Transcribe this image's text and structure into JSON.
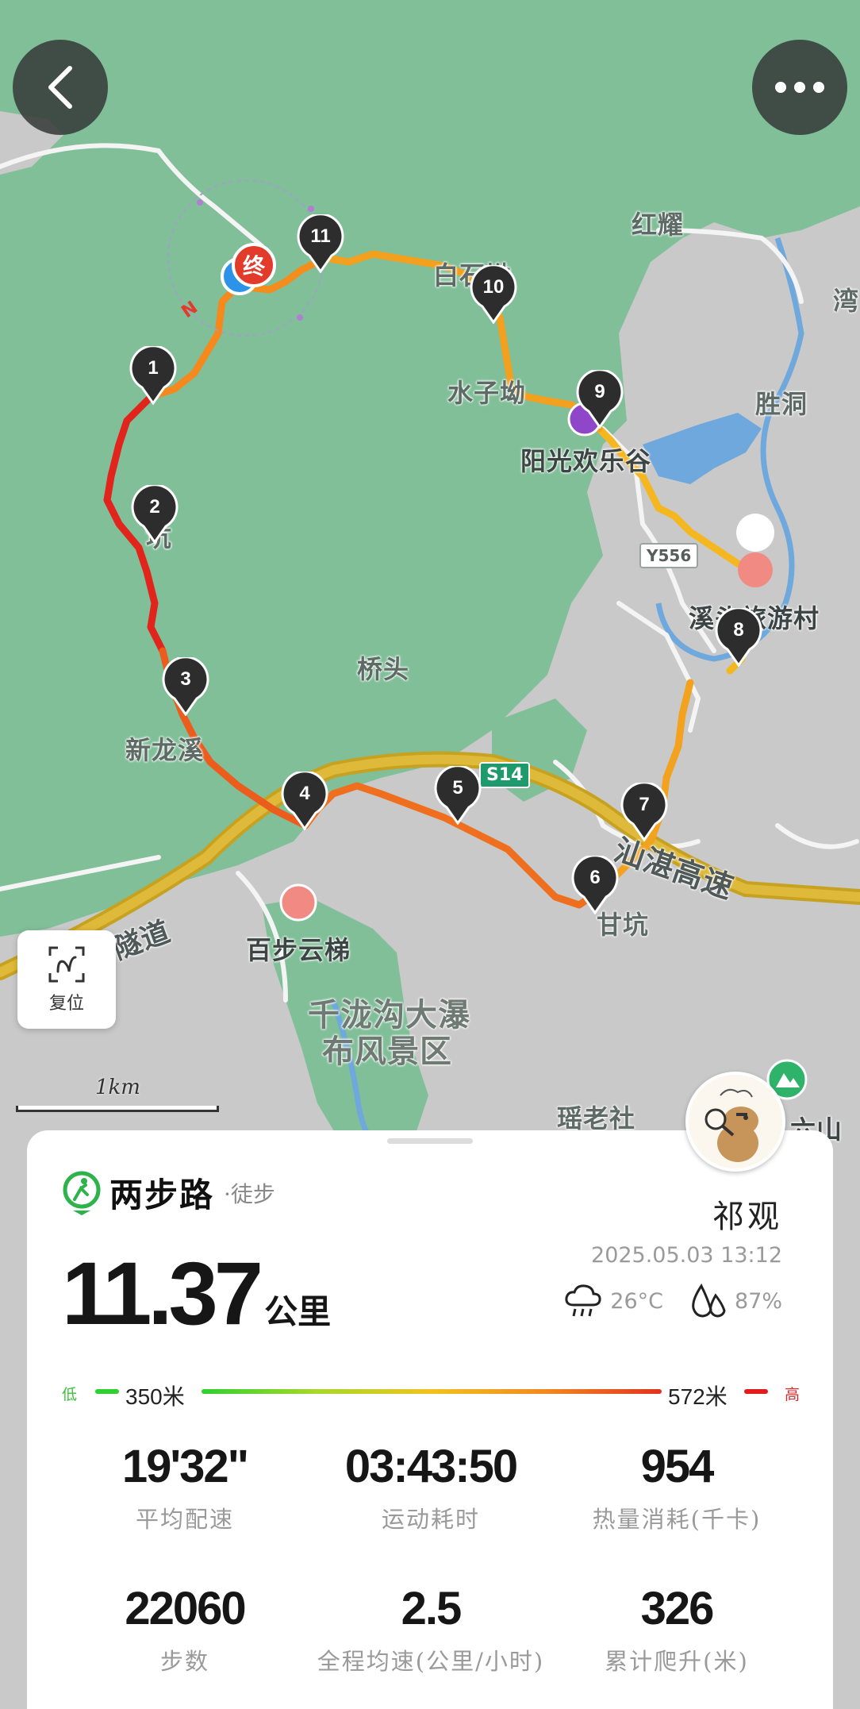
{
  "map": {
    "place_labels": {
      "hongyao": "红耀",
      "wan": "湾",
      "baishiao": "白石坳",
      "shuiziao": "水子坳",
      "shengdong": "胜洞",
      "yangguang": "阳光欢乐谷",
      "lukeng": "坑",
      "xitou": "溪头旅游村",
      "qiaotou": "桥头",
      "xinlongxi": "新龙溪",
      "ganlkeng": "甘坑",
      "baibu": "百步云梯",
      "qianlong_1": "千泷沟大瀑",
      "qianlong_2": "布风景区",
      "yaolao": "瑶老社",
      "liushan": "六山",
      "suidao": "隧道",
      "highway": "汕湛高速"
    },
    "road_badges": {
      "y556": "Y556",
      "s14": "S14"
    },
    "route_markers": [
      "1",
      "2",
      "3",
      "4",
      "5",
      "6",
      "7",
      "8",
      "9",
      "10",
      "11"
    ],
    "end_marker": "终",
    "compass": "N",
    "reset_label": "复位",
    "scale_label": "1km",
    "icons": {
      "back": "chevron-left-icon",
      "more": "more-dots-icon",
      "reset": "route-reset-icon"
    }
  },
  "summary": {
    "brand_name": "两步路",
    "activity_type": "·徒步",
    "user_name": "祁观",
    "datetime": "2025.05.03 13:12",
    "temperature": "26°C",
    "humidity": "87%",
    "distance_value": "11.37",
    "distance_unit": "公里",
    "elevation": {
      "low_label": "低",
      "high_label": "高",
      "min": "350米",
      "max": "572米"
    },
    "stats": [
      {
        "value": "19'32\"",
        "label": "平均配速"
      },
      {
        "value": "03:43:50",
        "label": "运动耗时"
      },
      {
        "value": "954",
        "label": "热量消耗(千卡)"
      },
      {
        "value": "22060",
        "label": "步数"
      },
      {
        "value": "2.5",
        "label": "全程均速(公里/小时)"
      },
      {
        "value": "326",
        "label": "累计爬升(米)"
      }
    ],
    "colors": {
      "route_low": "#2fd02f",
      "route_high": "#e11c1c",
      "brand_green": "#2db34a"
    }
  }
}
